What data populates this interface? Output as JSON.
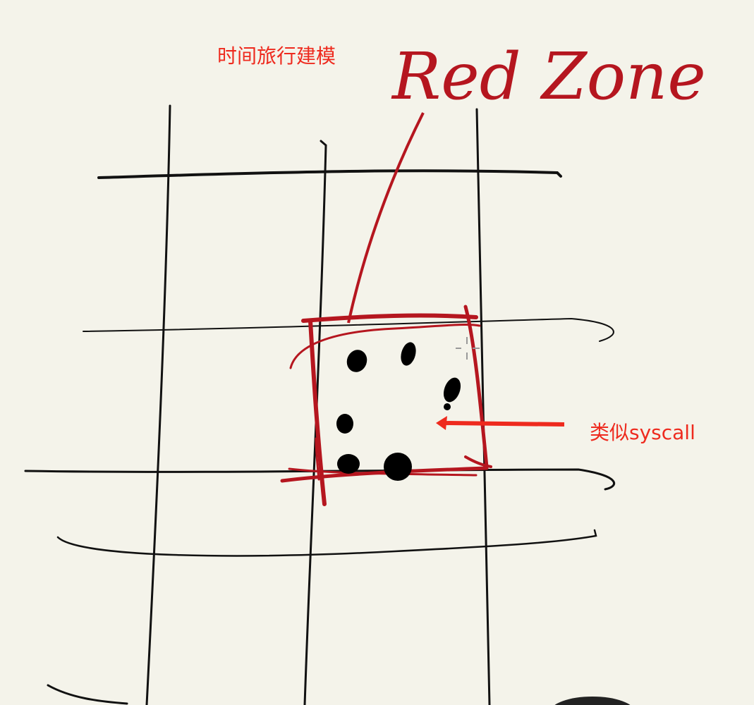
{
  "title": "时间旅行建模",
  "handwritten_label": "Red Zone",
  "annotation": "类似syscall",
  "colors": {
    "paper": "#f4f3ea",
    "ink": "#111111",
    "red_ink": "#b5161f",
    "annotation_red": "#ee2a1e"
  },
  "dots_in_zone": 7
}
